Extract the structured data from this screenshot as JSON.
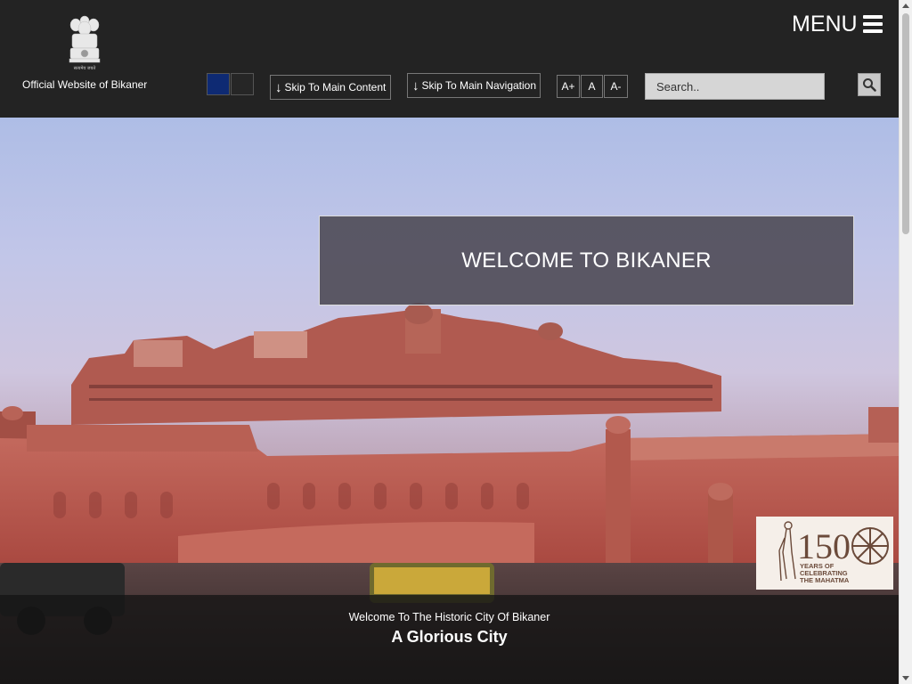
{
  "header": {
    "site_title": "Official Website of Bikaner",
    "emblem_icon": "national-emblem-icon",
    "emblem_motto": "सत्यमेव जयते",
    "menu_label": "MENU",
    "menu_icon": "hamburger-icon"
  },
  "accessibility": {
    "themes": [
      {
        "name": "blue",
        "color": "#0e2a73"
      },
      {
        "name": "dark",
        "color": "#262626"
      }
    ],
    "skip_main_content": "Skip To Main Content",
    "skip_main_navigation": "Skip To Main Navigation",
    "skip_arrow": "↓",
    "font_increase": "A+",
    "font_normal": "A",
    "font_decrease": "A-"
  },
  "search": {
    "placeholder": "Search..",
    "icon": "search-icon"
  },
  "hero": {
    "welcome_text": "WELCOME TO BIKANER",
    "caption_small": "Welcome To The Historic City Of Bikaner",
    "caption_big": "A Glorious City",
    "badge": {
      "number": "150",
      "line1": "YEARS OF",
      "line2": "CELEBRATING",
      "line3": "THE MAHATMA"
    }
  },
  "colors": {
    "header_bg": "#232323",
    "fort_red": "#b8574f",
    "caption_bg": "#141414"
  }
}
